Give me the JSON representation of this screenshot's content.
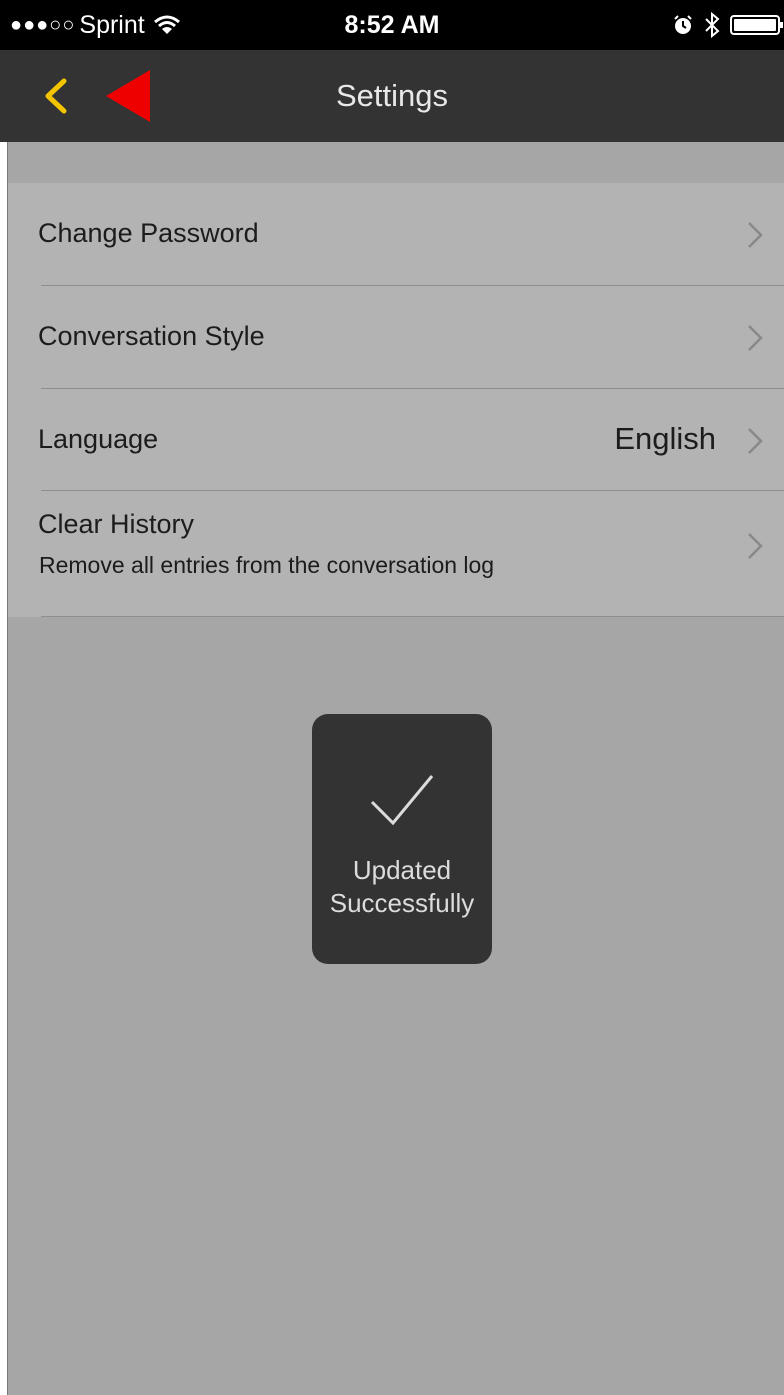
{
  "status_bar": {
    "signal_dots": "●●●○○",
    "carrier": "Sprint",
    "time": "8:52 AM",
    "icons": [
      "wifi-icon",
      "alarm-icon",
      "bluetooth-icon",
      "battery-icon"
    ]
  },
  "nav": {
    "title": "Settings",
    "back_icon": "chevron-left-icon",
    "annotation_icon": "red-triangle-arrow-icon"
  },
  "settings": {
    "items": [
      {
        "label": "Change Password"
      },
      {
        "label": "Conversation Style"
      },
      {
        "label": "Language",
        "value": "English"
      },
      {
        "label": "Clear History",
        "sublabel": "Remove all entries from the conversation log"
      }
    ]
  },
  "toast": {
    "line1": "Updated",
    "line2": "Successfully",
    "icon": "checkmark-icon"
  },
  "colors": {
    "accent": "#f5c400",
    "annotation": "#ee0000",
    "nav_background": "#333333",
    "page_background": "#a6a6a6"
  }
}
